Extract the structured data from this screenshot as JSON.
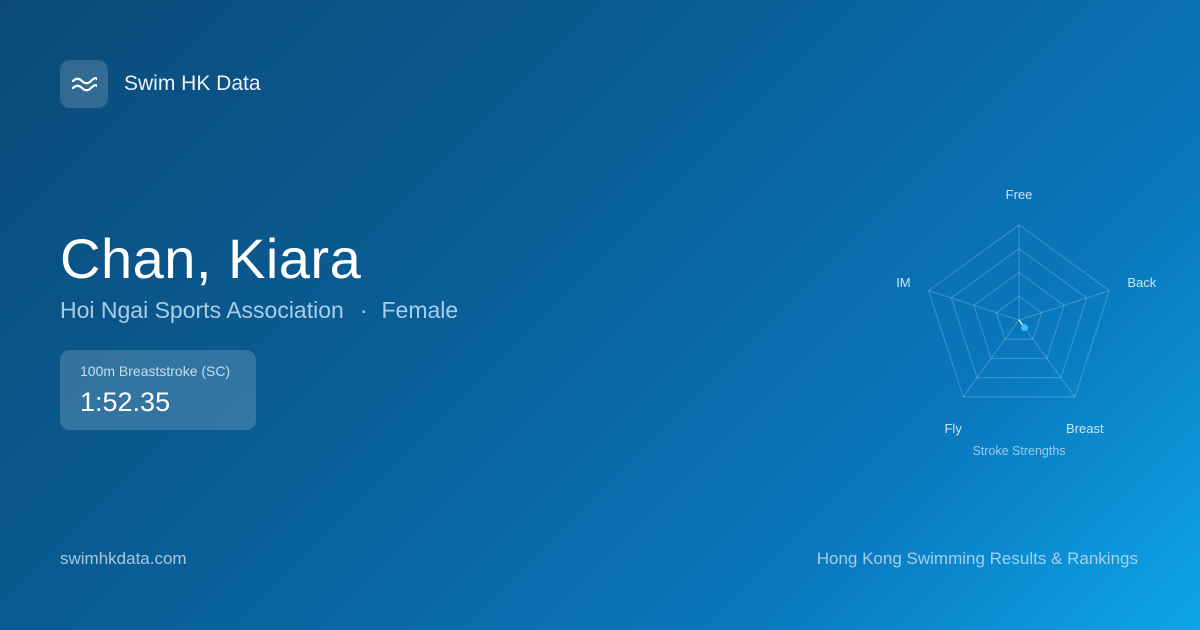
{
  "brand": {
    "name": "Swim HK Data",
    "icon": "waves-icon"
  },
  "athlete": {
    "name": "Chan, Kiara",
    "club": "Hoi Ngai Sports Association",
    "separator": "·",
    "gender": "Female"
  },
  "event": {
    "name": "100m Breaststroke  (SC)",
    "time": "1:52.35"
  },
  "chart_data": {
    "type": "radar",
    "title": "Stroke Strengths",
    "axes": [
      "Free",
      "Back",
      "Breast",
      "Fly",
      "IM"
    ],
    "values": [
      0,
      0,
      0.1,
      0,
      0
    ],
    "rings": 4,
    "range": [
      0,
      1
    ],
    "grid": true,
    "point_color": "#38bdf8"
  },
  "footer": {
    "site": "swimhkdata.com",
    "tagline": "Hong Kong Swimming Results & Rankings"
  }
}
